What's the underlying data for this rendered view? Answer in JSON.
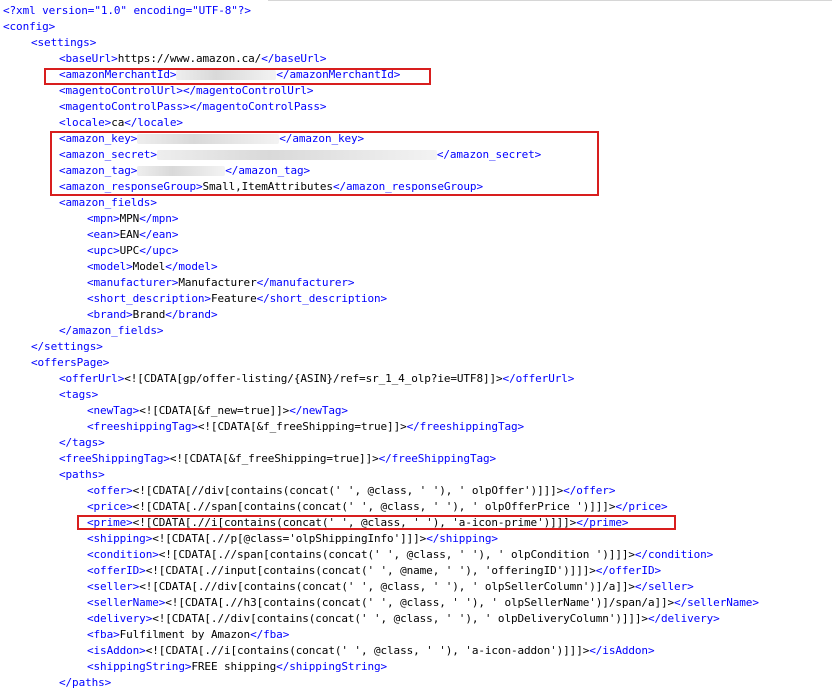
{
  "highlight_color": "#d81e1e",
  "tag_color": "#0000ff",
  "lines": [
    {
      "indent": 0,
      "parts": [
        {
          "t": "tag",
          "v": "<?xml version=\"1.0\" encoding=\"UTF-8\"?>"
        }
      ]
    },
    {
      "indent": 0,
      "parts": [
        {
          "t": "tag",
          "v": "<config>"
        }
      ]
    },
    {
      "indent": 1,
      "parts": [
        {
          "t": "tag",
          "v": "<settings>"
        }
      ]
    },
    {
      "indent": 2,
      "parts": [
        {
          "t": "tag",
          "v": "<baseUrl>"
        },
        {
          "t": "text",
          "v": "https://www.amazon.ca/"
        },
        {
          "t": "tag",
          "v": "</baseUrl>"
        }
      ]
    },
    {
      "indent": 2,
      "parts": [
        {
          "t": "tag",
          "v": "<amazonMerchantId>"
        },
        {
          "t": "blur",
          "w": 100
        },
        {
          "t": "tag",
          "v": "</amazonMerchantId>"
        }
      ]
    },
    {
      "indent": 2,
      "parts": [
        {
          "t": "tag",
          "v": "<magentoControlUrl>"
        },
        {
          "t": "tag",
          "v": "</magentoControlUrl>"
        }
      ]
    },
    {
      "indent": 2,
      "parts": [
        {
          "t": "tag",
          "v": "<magentoControlPass>"
        },
        {
          "t": "tag",
          "v": "</magentoControlPass>"
        }
      ]
    },
    {
      "indent": 2,
      "parts": [
        {
          "t": "tag",
          "v": "<locale>"
        },
        {
          "t": "text",
          "v": "ca"
        },
        {
          "t": "tag",
          "v": "</locale>"
        }
      ]
    },
    {
      "indent": 2,
      "parts": [
        {
          "t": "tag",
          "v": "<amazon_key>"
        },
        {
          "t": "blur",
          "w": 142
        },
        {
          "t": "tag",
          "v": "</amazon_key>"
        }
      ]
    },
    {
      "indent": 2,
      "parts": [
        {
          "t": "tag",
          "v": "<amazon_secret>"
        },
        {
          "t": "blur",
          "w": 280
        },
        {
          "t": "tag",
          "v": "</amazon_secret>"
        }
      ]
    },
    {
      "indent": 2,
      "parts": [
        {
          "t": "tag",
          "v": "<amazon_tag>"
        },
        {
          "t": "blur",
          "w": 88
        },
        {
          "t": "tag",
          "v": "</amazon_tag>"
        }
      ]
    },
    {
      "indent": 2,
      "parts": [
        {
          "t": "tag",
          "v": "<amazon_responseGroup>"
        },
        {
          "t": "text",
          "v": "Small,ItemAttributes"
        },
        {
          "t": "tag",
          "v": "</amazon_responseGroup>"
        }
      ]
    },
    {
      "indent": 2,
      "parts": [
        {
          "t": "tag",
          "v": "<amazon_fields>"
        }
      ]
    },
    {
      "indent": 3,
      "parts": [
        {
          "t": "tag",
          "v": "<mpn>"
        },
        {
          "t": "text",
          "v": "MPN"
        },
        {
          "t": "tag",
          "v": "</mpn>"
        }
      ]
    },
    {
      "indent": 3,
      "parts": [
        {
          "t": "tag",
          "v": "<ean>"
        },
        {
          "t": "text",
          "v": "EAN"
        },
        {
          "t": "tag",
          "v": "</ean>"
        }
      ]
    },
    {
      "indent": 3,
      "parts": [
        {
          "t": "tag",
          "v": "<upc>"
        },
        {
          "t": "text",
          "v": "UPC"
        },
        {
          "t": "tag",
          "v": "</upc>"
        }
      ]
    },
    {
      "indent": 3,
      "parts": [
        {
          "t": "tag",
          "v": "<model>"
        },
        {
          "t": "text",
          "v": "Model"
        },
        {
          "t": "tag",
          "v": "</model>"
        }
      ]
    },
    {
      "indent": 3,
      "parts": [
        {
          "t": "tag",
          "v": "<manufacturer>"
        },
        {
          "t": "text",
          "v": "Manufacturer"
        },
        {
          "t": "tag",
          "v": "</manufacturer>"
        }
      ]
    },
    {
      "indent": 3,
      "parts": [
        {
          "t": "tag",
          "v": "<short_description>"
        },
        {
          "t": "text",
          "v": "Feature"
        },
        {
          "t": "tag",
          "v": "</short_description>"
        }
      ]
    },
    {
      "indent": 3,
      "parts": [
        {
          "t": "tag",
          "v": "<brand>"
        },
        {
          "t": "text",
          "v": "Brand"
        },
        {
          "t": "tag",
          "v": "</brand>"
        }
      ]
    },
    {
      "indent": 2,
      "parts": [
        {
          "t": "tag",
          "v": "</amazon_fields>"
        }
      ]
    },
    {
      "indent": 1,
      "parts": [
        {
          "t": "tag",
          "v": "</settings>"
        }
      ]
    },
    {
      "indent": 1,
      "parts": [
        {
          "t": "tag",
          "v": "<offersPage>"
        }
      ]
    },
    {
      "indent": 2,
      "parts": [
        {
          "t": "tag",
          "v": "<offerUrl>"
        },
        {
          "t": "text",
          "v": "<![CDATA[gp/offer-listing/{ASIN}/ref=sr_1_4_olp?ie=UTF8]]>"
        },
        {
          "t": "tag",
          "v": "</offerUrl>"
        }
      ]
    },
    {
      "indent": 2,
      "parts": [
        {
          "t": "tag",
          "v": "<tags>"
        }
      ]
    },
    {
      "indent": 3,
      "parts": [
        {
          "t": "tag",
          "v": "<newTag>"
        },
        {
          "t": "text",
          "v": "<![CDATA[&f_new=true]]>"
        },
        {
          "t": "tag",
          "v": "</newTag>"
        }
      ]
    },
    {
      "indent": 3,
      "parts": [
        {
          "t": "tag",
          "v": "<freeshippingTag>"
        },
        {
          "t": "text",
          "v": "<![CDATA[&f_freeShipping=true]]>"
        },
        {
          "t": "tag",
          "v": "</freeshippingTag>"
        }
      ]
    },
    {
      "indent": 2,
      "parts": [
        {
          "t": "tag",
          "v": "</tags>"
        }
      ]
    },
    {
      "indent": 2,
      "parts": [
        {
          "t": "tag",
          "v": "<freeShippingTag>"
        },
        {
          "t": "text",
          "v": "<![CDATA[&f_freeShipping=true]]>"
        },
        {
          "t": "tag",
          "v": "</freeShippingTag>"
        }
      ]
    },
    {
      "indent": 2,
      "parts": [
        {
          "t": "tag",
          "v": "<paths>"
        }
      ]
    },
    {
      "indent": 3,
      "parts": [
        {
          "t": "tag",
          "v": "<offer>"
        },
        {
          "t": "text",
          "v": "<![CDATA[//div[contains(concat(' ', @class, ' '), ' olpOffer')]]]>"
        },
        {
          "t": "tag",
          "v": "</offer>"
        }
      ]
    },
    {
      "indent": 3,
      "parts": [
        {
          "t": "tag",
          "v": "<price>"
        },
        {
          "t": "text",
          "v": "<![CDATA[.//span[contains(concat(' ', @class, ' '), ' olpOfferPrice ')]]]>"
        },
        {
          "t": "tag",
          "v": "</price>"
        }
      ]
    },
    {
      "indent": 3,
      "parts": [
        {
          "t": "tag",
          "v": "<prime>"
        },
        {
          "t": "text",
          "v": "<![CDATA[.//i[contains(concat(' ', @class, ' '), 'a-icon-prime')]]]>"
        },
        {
          "t": "tag",
          "v": "</prime>"
        }
      ]
    },
    {
      "indent": 3,
      "parts": [
        {
          "t": "tag",
          "v": "<shipping>"
        },
        {
          "t": "text",
          "v": "<![CDATA[.//p[@class='olpShippingInfo']]]>"
        },
        {
          "t": "tag",
          "v": "</shipping>"
        }
      ]
    },
    {
      "indent": 3,
      "parts": [
        {
          "t": "tag",
          "v": "<condition>"
        },
        {
          "t": "text",
          "v": "<![CDATA[.//span[contains(concat(' ', @class, ' '), ' olpCondition ')]]]>"
        },
        {
          "t": "tag",
          "v": "</condition>"
        }
      ]
    },
    {
      "indent": 3,
      "parts": [
        {
          "t": "tag",
          "v": "<offerID>"
        },
        {
          "t": "text",
          "v": "<![CDATA[.//input[contains(concat(' ', @name, ' '), 'offeringID')]]]>"
        },
        {
          "t": "tag",
          "v": "</offerID>"
        }
      ]
    },
    {
      "indent": 3,
      "parts": [
        {
          "t": "tag",
          "v": "<seller>"
        },
        {
          "t": "text",
          "v": "<![CDATA[.//div[contains(concat(' ', @class, ' '), ' olpSellerColumn')]/a]]>"
        },
        {
          "t": "tag",
          "v": "</seller>"
        }
      ]
    },
    {
      "indent": 3,
      "parts": [
        {
          "t": "tag",
          "v": "<sellerName>"
        },
        {
          "t": "text",
          "v": "<![CDATA[.//h3[contains(concat(' ', @class, ' '), ' olpSellerName')]/span/a]]>"
        },
        {
          "t": "tag",
          "v": "</sellerName>"
        }
      ]
    },
    {
      "indent": 3,
      "parts": [
        {
          "t": "tag",
          "v": "<delivery>"
        },
        {
          "t": "text",
          "v": "<![CDATA[.//div[contains(concat(' ', @class, ' '), ' olpDeliveryColumn')]]]>"
        },
        {
          "t": "tag",
          "v": "</delivery>"
        }
      ]
    },
    {
      "indent": 3,
      "parts": [
        {
          "t": "tag",
          "v": "<fba>"
        },
        {
          "t": "text",
          "v": "Fulfilment by Amazon"
        },
        {
          "t": "tag",
          "v": "</fba>"
        }
      ]
    },
    {
      "indent": 3,
      "parts": [
        {
          "t": "tag",
          "v": "<isAddon>"
        },
        {
          "t": "text",
          "v": "<![CDATA[.//i[contains(concat(' ', @class, ' '), 'a-icon-addon')]]]>"
        },
        {
          "t": "tag",
          "v": "</isAddon>"
        }
      ]
    },
    {
      "indent": 3,
      "parts": [
        {
          "t": "tag",
          "v": "<shippingString>"
        },
        {
          "t": "text",
          "v": "FREE shipping"
        },
        {
          "t": "tag",
          "v": "</shippingString>"
        }
      ]
    },
    {
      "indent": 2,
      "parts": [
        {
          "t": "tag",
          "v": "</paths>"
        }
      ]
    }
  ]
}
